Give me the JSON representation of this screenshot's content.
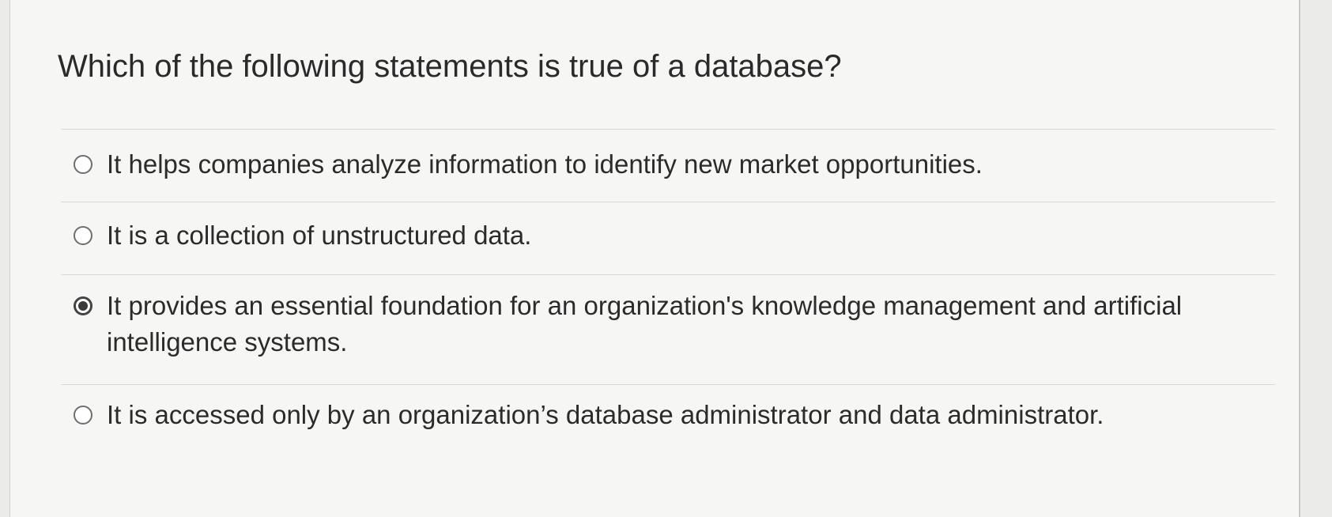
{
  "question": {
    "text": "Which of the following statements is true of a database?"
  },
  "options": [
    {
      "label": "It helps companies analyze information to identify new market opportunities.",
      "selected": false
    },
    {
      "label": "It is a collection of unstructured data.",
      "selected": false
    },
    {
      "label": "It provides an essential foundation for an organization's knowledge management and artificial intelligence systems.",
      "selected": true
    },
    {
      "label": "It is accessed only by an organization’s database administrator and data administrator.",
      "selected": false
    }
  ]
}
